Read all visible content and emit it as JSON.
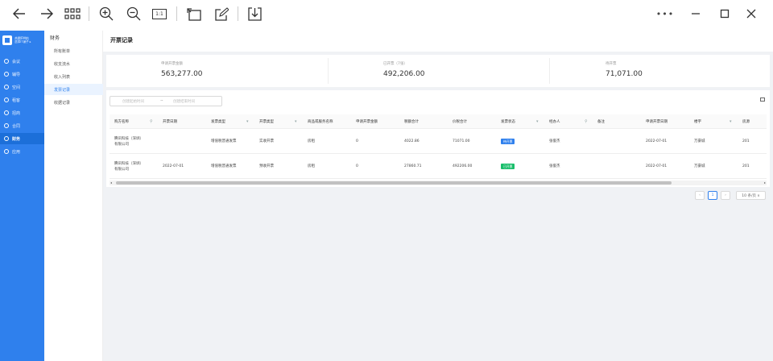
{
  "toolbar": {
    "icons": [
      "back-arrow-icon",
      "forward-arrow-icon",
      "grid-apps-icon",
      "zoom-in-icon",
      "zoom-out-icon",
      "actual-size-icon",
      "rotate-icon",
      "edit-icon",
      "download-icon"
    ],
    "actual_size_label": "1:1",
    "window": {
      "more": "•••",
      "minimize": "—",
      "maximize": "□",
      "close": "✕"
    }
  },
  "brand": {
    "name": "合肥FM钻",
    "sub": "选择IT铺子 ▸"
  },
  "nav": [
    {
      "label": "会议",
      "icon": "clock-icon"
    },
    {
      "label": "辅导",
      "icon": "book-icon"
    },
    {
      "label": "空间",
      "icon": "cube-icon"
    },
    {
      "label": "租客",
      "icon": "home-icon"
    },
    {
      "label": "招商",
      "icon": "target-icon"
    },
    {
      "label": "合同",
      "icon": "document-icon"
    },
    {
      "label": "财务",
      "icon": "finance-icon",
      "active": true
    },
    {
      "label": "应用",
      "icon": "apps-icon"
    }
  ],
  "subnav": {
    "title": "财务",
    "items": [
      {
        "label": "所有账单"
      },
      {
        "label": "收支流水"
      },
      {
        "label": "收入列表"
      },
      {
        "label": "发票记录",
        "active": true
      },
      {
        "label": "收据记录"
      }
    ]
  },
  "page": {
    "title": "开票记录"
  },
  "stats": [
    {
      "label": "申请开票金额",
      "value": "563,277.00"
    },
    {
      "label": "已开票（7张）",
      "value": "492,206.00"
    },
    {
      "label": "待开票",
      "value": "71,071.00"
    }
  ],
  "filter": {
    "start": "创建起始时间",
    "sep": "~",
    "end": "创建结束时间"
  },
  "table": {
    "columns": [
      "购方名称",
      "开票日期",
      "发票类型",
      "开票类型",
      "商品或服务名称",
      "申请开票金额",
      "税额合计",
      "价税合计",
      "发票状态",
      "经办人",
      "备注",
      "申请开票日期",
      "楼宇",
      "房源"
    ],
    "rows": [
      {
        "buyer": [
          "腾讯科技（深圳）",
          "有限公司"
        ],
        "date": "",
        "invoice_type": "增值税普通发票",
        "issue_type": "实收开票",
        "goods": "房租",
        "apply_amount": "0",
        "tax": "4022.86",
        "total": "71071.00",
        "status": "待开票",
        "status_color": "#2f80ed",
        "handler": "张俊杰",
        "note": "",
        "apply_date": "2022-07-01",
        "building": "万豪城",
        "room": "201"
      },
      {
        "buyer": [
          "腾讯科技（深圳）",
          "有限公司"
        ],
        "date": "2022-07-01",
        "invoice_type": "增值税普通发票",
        "issue_type": "预收开票",
        "goods": "房租",
        "apply_amount": "0",
        "tax": "27860.71",
        "total": "492206.00",
        "status": "已开票",
        "status_color": "#19be6b",
        "handler": "张俊杰",
        "note": "",
        "apply_date": "2022-07-01",
        "building": "万豪城",
        "room": "201"
      }
    ]
  },
  "pagination": {
    "prev": "‹",
    "page": "1",
    "next": "›",
    "size": "10 条/页 ∨"
  }
}
